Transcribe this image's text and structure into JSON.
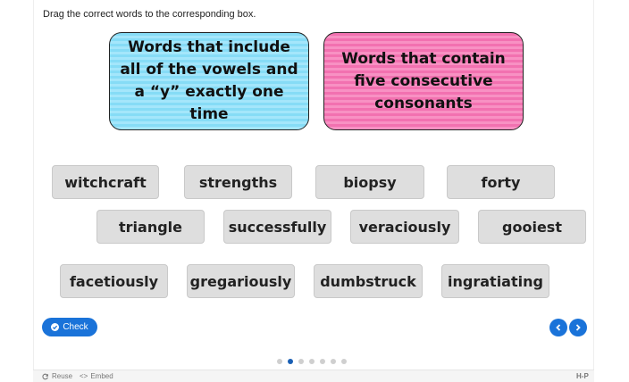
{
  "instruction": "Drag the correct words to the corresponding box.",
  "dropzones": [
    {
      "label": "Words that include all of the vowels and a “y” exactly one time",
      "color": "#a4e6fb"
    },
    {
      "label": "Words that contain five consecutive consonants",
      "color": "#f891c3"
    }
  ],
  "words": [
    "witchcraft",
    "strengths",
    "biopsy",
    "forty",
    "triangle",
    "successfully",
    "veraciously",
    "gooiest",
    "facetiously",
    "gregariously",
    "dumbstruck",
    "ingratiating"
  ],
  "check_label": "Check",
  "pagination": {
    "total": 7,
    "current": 2
  },
  "footer": {
    "reuse": "Reuse",
    "embed": "Embed",
    "logo": "H-P"
  },
  "colors": {
    "accent": "#1a73d9",
    "word_bg": "#dedede"
  },
  "icons": [
    "check-circle-icon",
    "chevron-left-icon",
    "chevron-right-icon",
    "reuse-icon",
    "embed-icon",
    "h5p-logo-icon"
  ]
}
